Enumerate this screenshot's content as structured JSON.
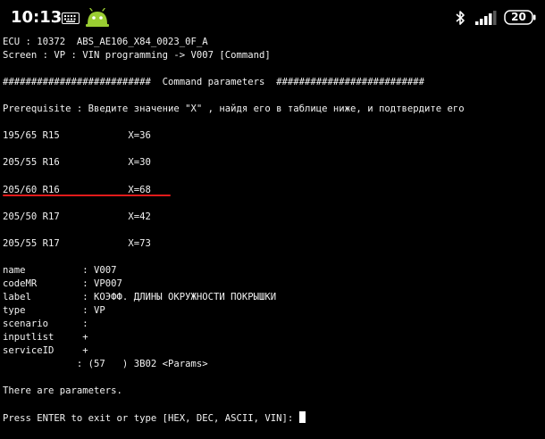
{
  "status_bar": {
    "time": "10:13",
    "battery": "20",
    "icons": [
      "keyboard-icon",
      "android-icon",
      "bluetooth-icon",
      "signal-icon",
      "battery-icon"
    ]
  },
  "colors": {
    "background": "#000000",
    "text": "#f2f2f2",
    "annotation": "#e21b1b"
  },
  "terminal": {
    "lines": [
      "ECU : 10372  ABS_AE106_X84_0023_0F_A",
      "Screen : VP : VIN programming -> V007 [Command]",
      "",
      "##########################  Command parameters  ##########################",
      "",
      "Prerequisite : Введите значение \"X\" , найдя его в таблице ниже, и подтвердите его",
      "",
      "195/65 R15            X=36",
      "",
      "205/55 R16            X=30",
      "",
      "205/60 R16            X=68",
      "",
      "205/50 R17            X=42",
      "",
      "205/55 R17            X=73",
      "",
      "name          : V007",
      "codeMR        : VP007",
      "label         : КОЭФФ. ДЛИНЫ ОКРУЖНОСТИ ПОКРЫШКИ",
      "type          : VP",
      "scenario      :",
      "inputlist     +",
      "serviceID     +",
      "             : (57   ) 3B02 <Params>",
      "",
      "There are parameters.",
      "",
      "Press ENTER to exit or type [HEX, DEC, ASCII, VIN]: "
    ]
  }
}
